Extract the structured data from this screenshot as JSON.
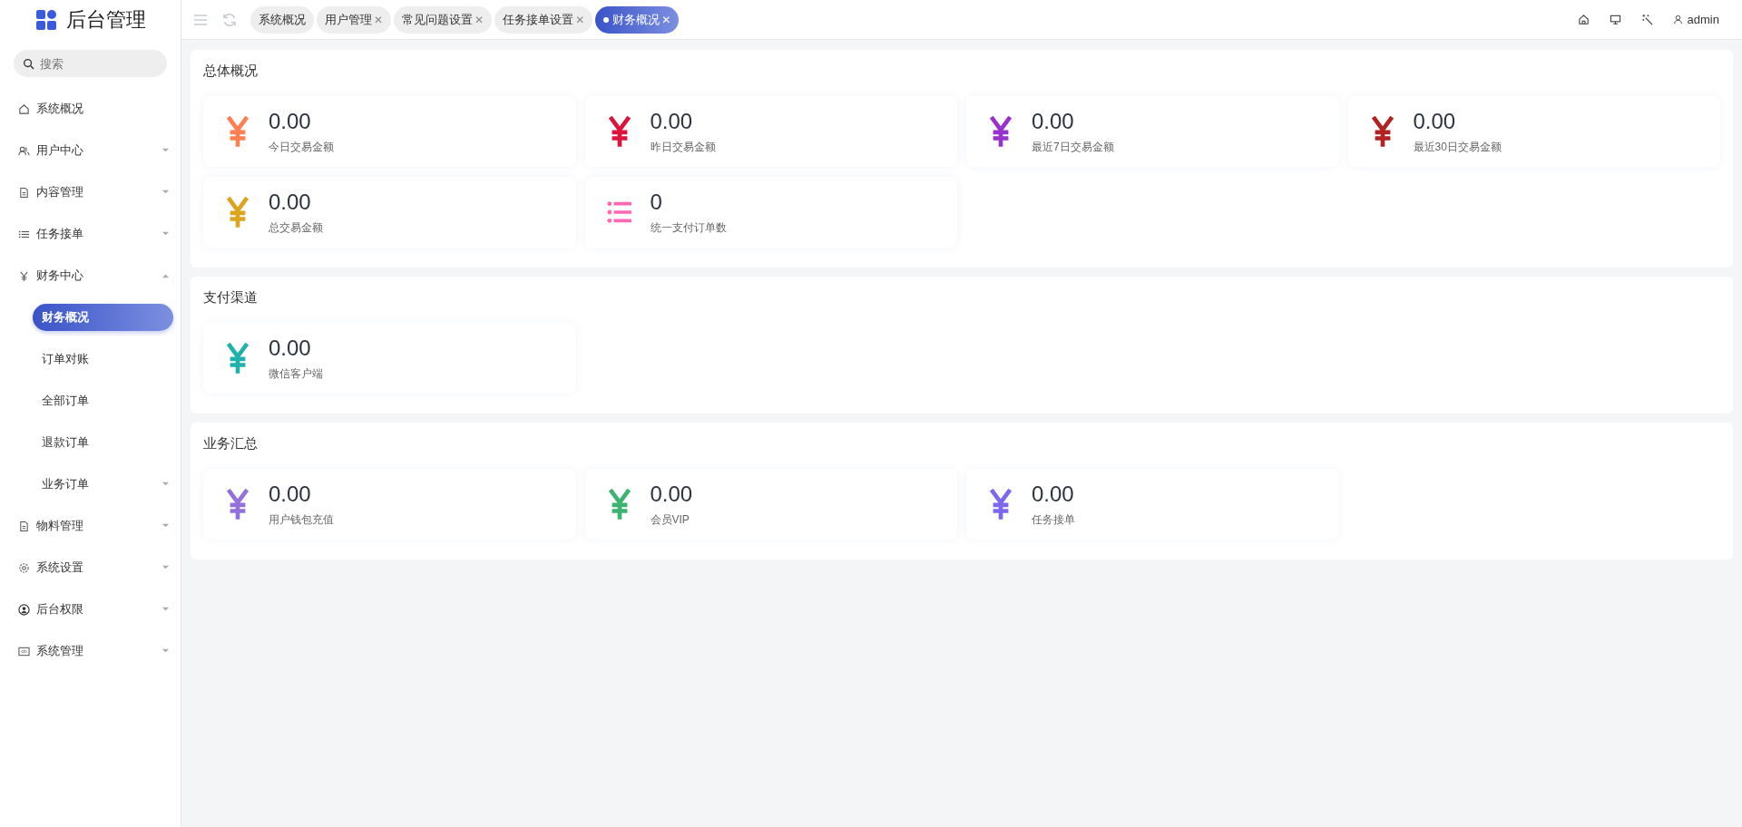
{
  "sidebar": {
    "title": "后台管理",
    "search": {
      "placeholder": "搜索"
    },
    "items": [
      {
        "label": "系统概况",
        "kind": "home",
        "selected": false
      },
      {
        "label": "用户中心",
        "kind": "users",
        "selected": false,
        "expanded": false
      },
      {
        "label": "内容管理",
        "kind": "document",
        "selected": false,
        "expanded": false
      },
      {
        "label": "任务接单",
        "kind": "list",
        "selected": false,
        "expanded": false
      },
      {
        "label": "财务中心",
        "kind": "yen",
        "selected": false,
        "expanded": true,
        "children": [
          {
            "label": "财务概况",
            "selected": true
          },
          {
            "label": "订单对账",
            "selected": false
          },
          {
            "label": "全部订单",
            "selected": false
          },
          {
            "label": "退款订单",
            "selected": false
          },
          {
            "label": "业务订单",
            "selected": false,
            "expanded": false
          }
        ]
      },
      {
        "label": "物料管理",
        "kind": "document",
        "selected": false,
        "expanded": false
      },
      {
        "label": "系统设置",
        "kind": "gear",
        "selected": false,
        "expanded": false
      },
      {
        "label": "后台权限",
        "kind": "account",
        "selected": false,
        "expanded": false
      },
      {
        "label": "系统管理",
        "kind": "code",
        "selected": false,
        "expanded": false
      }
    ]
  },
  "tabs": [
    {
      "label": "系统概况",
      "closable": false,
      "selected": false
    },
    {
      "label": "用户管理",
      "closable": true,
      "selected": false
    },
    {
      "label": "常见问题设置",
      "closable": true,
      "selected": false
    },
    {
      "label": "任务接单设置",
      "closable": true,
      "selected": false
    },
    {
      "label": "财务概况",
      "closable": true,
      "selected": true
    }
  ],
  "close_glyph": "✕",
  "user": {
    "name": "admin"
  },
  "sections": [
    {
      "title": "总体概况",
      "cards": [
        {
          "value": "0.00",
          "label": "今日交易金额",
          "kind": "yen",
          "color": "#ff7f50"
        },
        {
          "value": "0.00",
          "label": "昨日交易金额",
          "kind": "yen",
          "color": "#dc143c"
        },
        {
          "value": "0.00",
          "label": "最近7日交易金额",
          "kind": "yen",
          "color": "#9932cc"
        },
        {
          "value": "0.00",
          "label": "最近30日交易金额",
          "kind": "yen",
          "color": "#b22222"
        },
        {
          "value": "0.00",
          "label": "总交易金额",
          "kind": "yen",
          "color": "#daa520"
        },
        {
          "value": "0",
          "label": "统一支付订单数",
          "kind": "list",
          "color": "#ff69b4"
        }
      ]
    },
    {
      "title": "支付渠道",
      "cards": [
        {
          "value": "0.00",
          "label": "微信客户端",
          "kind": "yen",
          "color": "#20b2aa"
        }
      ]
    },
    {
      "title": "业务汇总",
      "cards": [
        {
          "value": "0.00",
          "label": "用户钱包充值",
          "kind": "yen",
          "color": "#9370db"
        },
        {
          "value": "0.00",
          "label": "会员VIP",
          "kind": "yen",
          "color": "#3cb371"
        },
        {
          "value": "0.00",
          "label": "任务接单",
          "kind": "yen",
          "color": "#7b68ee"
        }
      ]
    }
  ]
}
